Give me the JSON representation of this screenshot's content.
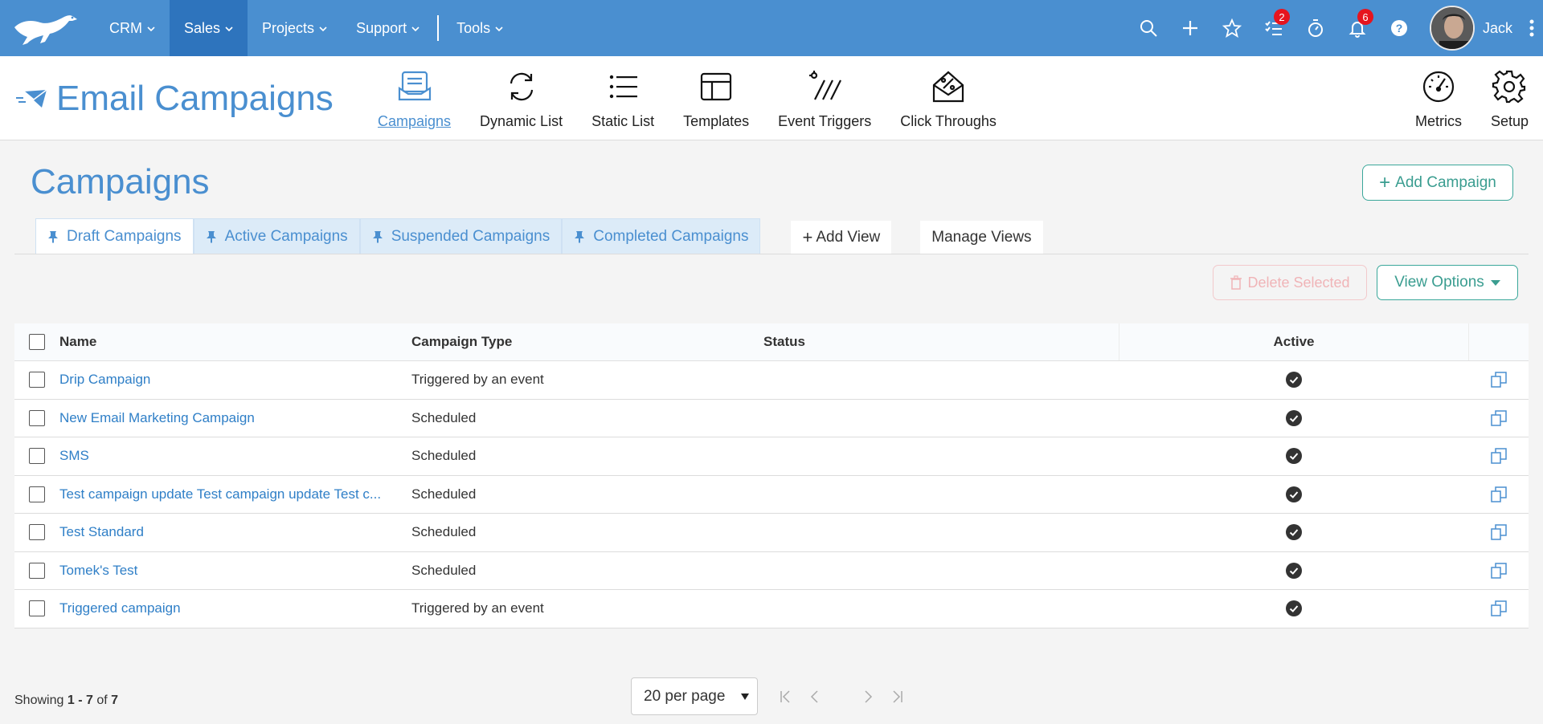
{
  "topnav": {
    "items": [
      {
        "label": "CRM",
        "active": false
      },
      {
        "label": "Sales",
        "active": true
      },
      {
        "label": "Projects",
        "active": false
      },
      {
        "label": "Support",
        "active": false
      },
      {
        "label": "Tools",
        "active": false
      }
    ],
    "badges": {
      "tasks": "2",
      "notifications": "6"
    },
    "user_name": "Jack",
    "brand_color": "#4a8fd0",
    "active_color": "#2e74bd"
  },
  "module": {
    "title": "Email Campaigns",
    "tabs": [
      {
        "label": "Campaigns",
        "icon": "campaigns-icon",
        "active": true
      },
      {
        "label": "Dynamic List",
        "icon": "refresh-icon",
        "active": false
      },
      {
        "label": "Static List",
        "icon": "list-icon",
        "active": false
      },
      {
        "label": "Templates",
        "icon": "template-icon",
        "active": false
      },
      {
        "label": "Event Triggers",
        "icon": "event-trigger-icon",
        "active": false
      },
      {
        "label": "Click Throughs",
        "icon": "click-through-icon",
        "active": false
      }
    ],
    "right_tabs": [
      {
        "label": "Metrics",
        "icon": "gauge-icon"
      },
      {
        "label": "Setup",
        "icon": "gear-icon"
      }
    ]
  },
  "page": {
    "title": "Campaigns",
    "add_button": "Add Campaign",
    "views": [
      "Draft Campaigns",
      "Active Campaigns",
      "Suspended Campaigns",
      "Completed Campaigns"
    ],
    "add_view": "Add View",
    "manage_views": "Manage Views",
    "delete_selected": "Delete Selected",
    "view_options": "View Options",
    "accent_color": "#3aa79a"
  },
  "table": {
    "columns": {
      "name": "Name",
      "type": "Campaign Type",
      "status": "Status",
      "active": "Active"
    },
    "rows": [
      {
        "name": "Drip Campaign",
        "type": "Triggered by an event",
        "status": "",
        "active": true
      },
      {
        "name": "New Email Marketing Campaign",
        "type": "Scheduled",
        "status": "",
        "active": true
      },
      {
        "name": "SMS",
        "type": "Scheduled",
        "status": "",
        "active": true
      },
      {
        "name": "Test campaign update Test campaign update Test c...",
        "type": "Scheduled",
        "status": "",
        "active": true
      },
      {
        "name": "Test Standard",
        "type": "Scheduled",
        "status": "",
        "active": true
      },
      {
        "name": "Tomek's Test",
        "type": "Scheduled",
        "status": "",
        "active": true
      },
      {
        "name": "Triggered campaign",
        "type": "Triggered by an event",
        "status": "",
        "active": true
      }
    ]
  },
  "footer": {
    "showing_prefix": "Showing",
    "from": "1",
    "dash": "-",
    "to": "7",
    "of_word": "of",
    "total": "7",
    "per_page": "20 per page"
  }
}
